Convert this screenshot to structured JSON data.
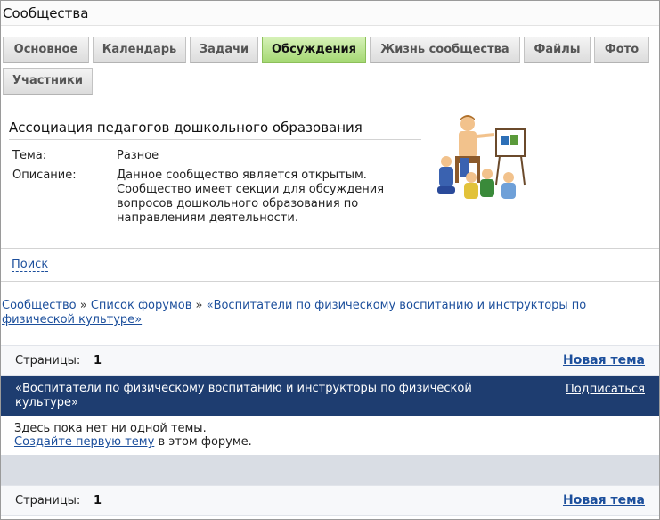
{
  "header": {
    "title": "Сообщества"
  },
  "tabs": [
    {
      "label": "Основное",
      "active": false
    },
    {
      "label": "Календарь",
      "active": false
    },
    {
      "label": "Задачи",
      "active": false
    },
    {
      "label": "Обсуждения",
      "active": true
    },
    {
      "label": "Жизнь сообщества",
      "active": false
    },
    {
      "label": "Файлы",
      "active": false
    },
    {
      "label": "Фото",
      "active": false
    },
    {
      "label": "Участники",
      "active": false
    }
  ],
  "community": {
    "name": "Ассоциация педагогов дошкольного образования",
    "theme_label": "Тема:",
    "theme_value": "Разное",
    "description_label": "Описание:",
    "description_lines": [
      "Данное сообщество является открытым.",
      "Сообщество имеет секции для обсуждения",
      "вопросов дошкольного образования по",
      "направлениям деятельности."
    ],
    "image": "teacher-with-children-illustration"
  },
  "search": {
    "label": "Поиск"
  },
  "breadcrumb": {
    "items": [
      "Сообщество",
      "Список форумов",
      "«Воспитатели по физическому воспитанию и инструкторы по физической культуре»"
    ],
    "separator": "»"
  },
  "pager_top": {
    "pages_label": "Страницы:",
    "page_number": "1",
    "new_topic": "Новая тема"
  },
  "forum": {
    "title_lines": [
      "«Воспитатели по физическому воспитанию и инструкторы по физической",
      "культуре»"
    ],
    "subscribe": "Подписаться"
  },
  "empty_state": {
    "line1": "Здесь пока нет ни одной темы.",
    "create_link": "Создайте первую тему",
    "line2_rest": " в этом форуме."
  },
  "pager_bottom": {
    "pages_label": "Страницы:",
    "page_number": "1",
    "new_topic": "Новая тема"
  },
  "colors": {
    "active_tab": "#a4d872",
    "forum_header": "#1e3d70",
    "link": "#1c4f9c"
  }
}
